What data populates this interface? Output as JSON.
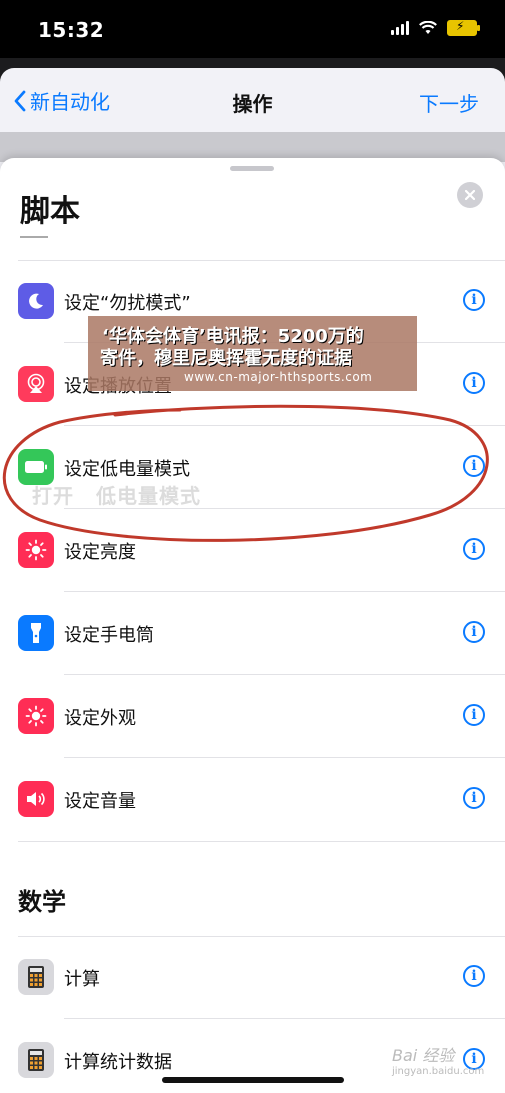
{
  "status_bar": {
    "time": "15:32"
  },
  "nav": {
    "back_label": "新自动化",
    "title": "操作",
    "next_label": "下一步"
  },
  "sheet": {
    "title": "脚本"
  },
  "actions": [
    {
      "label": "设定“勿扰模式”",
      "icon": "moon-icon",
      "color": "#5e5ce6"
    },
    {
      "label": "设定播放位置",
      "icon": "airplay-icon",
      "color": "#ff3b5c"
    },
    {
      "label": "设定低电量模式",
      "icon": "battery-icon",
      "color": "#34c759"
    },
    {
      "label": "设定亮度",
      "icon": "sun-icon",
      "color": "#ff2d55"
    },
    {
      "label": "设定手电筒",
      "icon": "flashlight-icon",
      "color": "#0a7aff"
    },
    {
      "label": "设定外观",
      "icon": "appearance-icon",
      "color": "#ff2d55"
    },
    {
      "label": "设定音量",
      "icon": "speaker-icon",
      "color": "#ff2d55"
    }
  ],
  "drag_preview": {
    "verb": "打开",
    "object": "低电量模式"
  },
  "section": {
    "title": "数学"
  },
  "math_actions": [
    {
      "label": "计算",
      "icon": "calculator-icon"
    },
    {
      "label": "计算统计数据",
      "icon": "calculator-icon"
    }
  ],
  "overlay": {
    "line1": "‘华体会体育’电讯报：5200万的",
    "line2": "寄件，穆里尼奥挥霍无度的证据",
    "line3": "www.cn-major-hthsports.com"
  },
  "watermark": {
    "text": "Bai 经验",
    "sub": "jingyan.baidu.com"
  },
  "colors": {
    "accent": "#0a7aff",
    "annotation": "#c0392b"
  }
}
